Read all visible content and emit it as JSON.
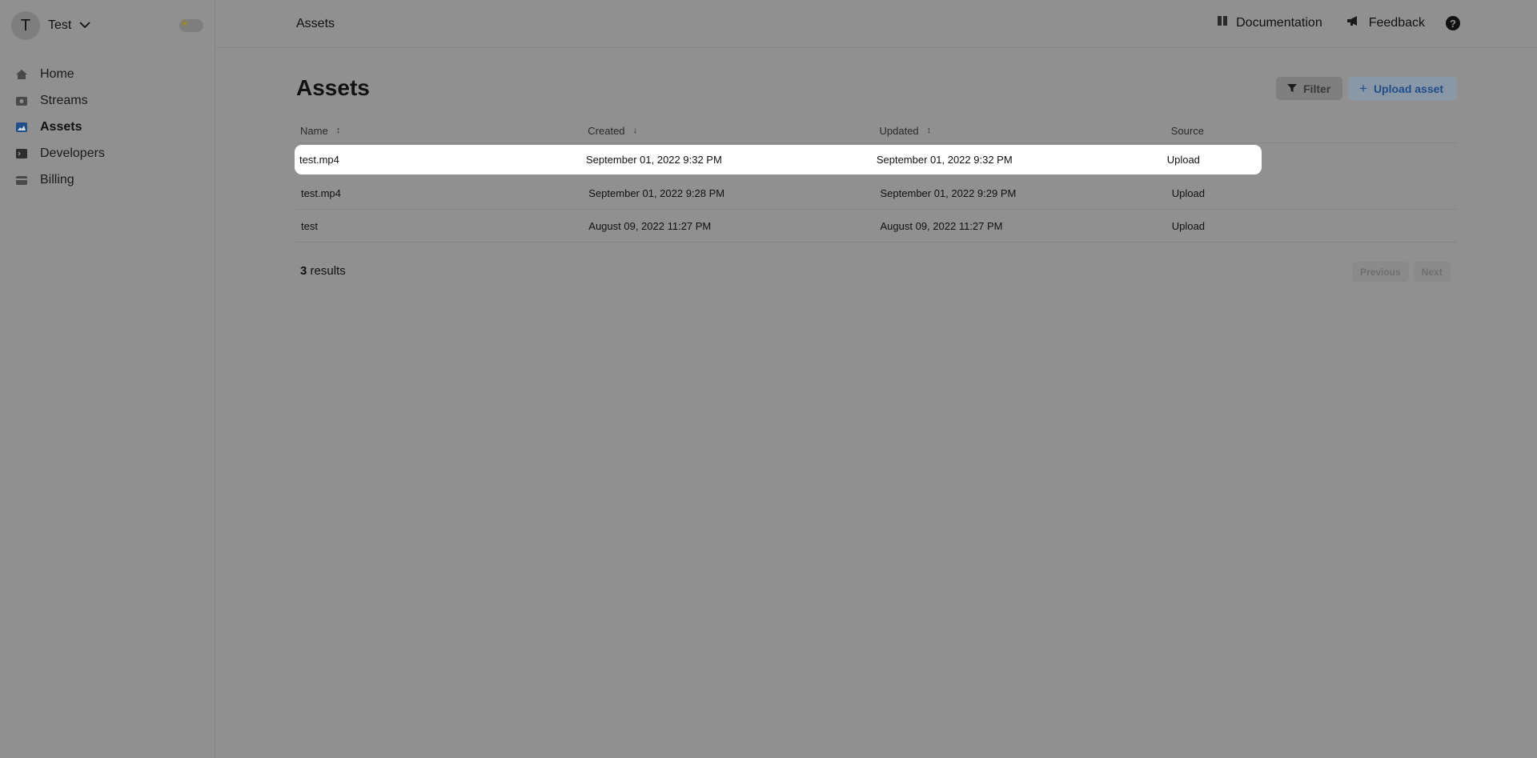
{
  "workspace": {
    "avatar_letter": "T",
    "name": "Test",
    "dropdown_icon": "chevron-down-icon"
  },
  "theme_toggle": {
    "icon": "sun-icon"
  },
  "sidebar": {
    "items": [
      {
        "label": "Home",
        "icon": "home-icon",
        "active": false
      },
      {
        "label": "Streams",
        "icon": "streams-icon",
        "active": false
      },
      {
        "label": "Assets",
        "icon": "assets-icon",
        "active": true
      },
      {
        "label": "Developers",
        "icon": "terminal-icon",
        "active": false
      },
      {
        "label": "Billing",
        "icon": "billing-icon",
        "active": false
      }
    ]
  },
  "topbar": {
    "breadcrumb": "Assets",
    "documentation_label": "Documentation",
    "feedback_label": "Feedback",
    "help_glyph": "?"
  },
  "main": {
    "title": "Assets",
    "filter_label": "Filter",
    "upload_label": "Upload asset",
    "upload_glyph": "+"
  },
  "table": {
    "columns": [
      {
        "label": "Name",
        "sort": "↕"
      },
      {
        "label": "Created",
        "sort": "↓"
      },
      {
        "label": "Updated",
        "sort": "↕"
      },
      {
        "label": "Source",
        "sort": ""
      }
    ],
    "rows": [
      {
        "name": "test.mp4",
        "created": "September 01, 2022 9:32 PM",
        "updated": "September 01, 2022 9:32 PM",
        "source": "Upload"
      },
      {
        "name": "test.mp4",
        "created": "September 01, 2022 9:28 PM",
        "updated": "September 01, 2022 9:29 PM",
        "source": "Upload"
      },
      {
        "name": "test",
        "created": "August 09, 2022 11:27 PM",
        "updated": "August 09, 2022 11:27 PM",
        "source": "Upload"
      }
    ]
  },
  "footer": {
    "results_count": "3",
    "results_label": " results",
    "previous_label": "Previous",
    "next_label": "Next"
  },
  "colors": {
    "overlay_background": "#909090",
    "accent": "#1f4f8a",
    "active_icon": "#1f4f8a"
  }
}
